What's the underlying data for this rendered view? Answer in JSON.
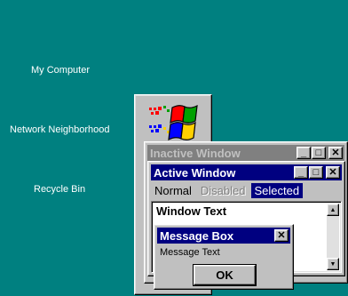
{
  "desktop": {
    "background": "#008080",
    "icons": [
      {
        "label": "My Computer"
      },
      {
        "label": "Network Neighborhood"
      },
      {
        "label": "Recycle Bin"
      }
    ]
  },
  "inactive_window": {
    "title": "Inactive Window",
    "buttons": {
      "minimize": "_",
      "maximize": "□",
      "close": "✕"
    }
  },
  "active_window": {
    "title": "Active Window",
    "buttons": {
      "minimize": "_",
      "maximize": "□",
      "close": "✕"
    },
    "menu": {
      "normal": "Normal",
      "disabled": "Disabled",
      "selected": "Selected"
    },
    "window_text": "Window Text"
  },
  "message_box": {
    "title": "Message Box",
    "close": "✕",
    "text": "Message Text",
    "ok_label": "OK"
  },
  "colors": {
    "active_title": "#000080",
    "inactive_title": "#808080",
    "face": "#c0c0c0"
  },
  "icons": {
    "logo": "windows-flag-icon",
    "scroll_up": "scroll-up-arrow-icon",
    "scroll_down": "scroll-down-arrow-icon"
  }
}
